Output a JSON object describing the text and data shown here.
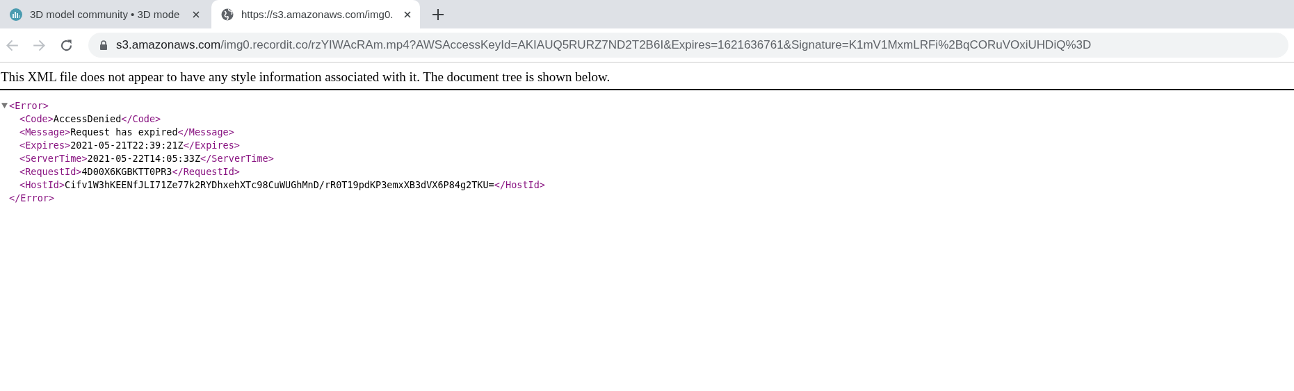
{
  "tabs": [
    {
      "title": "3D model community • 3D mode",
      "kind": "site",
      "selected": false
    },
    {
      "title": "https://s3.amazonaws.com/img0.",
      "kind": "web",
      "selected": true
    }
  ],
  "address_bar": {
    "host": "s3.amazonaws.com",
    "path": "/img0.recordit.co/rzYIWAcRAm.mp4?AWSAccessKeyId=AKIAUQ5RURZ7ND2T2B6I&Expires=1621636761&Signature=K1mV1MxmLRFi%2BqCORuVOxiUHDiQ%3D"
  },
  "notice": "This XML file does not appear to have any style information associated with it. The document tree is shown below.",
  "xml": {
    "open": "<Error>",
    "close": "</Error>",
    "expanded": true,
    "children": [
      {
        "open": "<Code>",
        "text": "AccessDenied",
        "close": "</Code>"
      },
      {
        "open": "<Message>",
        "text": "Request has expired",
        "close": "</Message>"
      },
      {
        "open": "<Expires>",
        "text": "2021-05-21T22:39:21Z",
        "close": "</Expires>"
      },
      {
        "open": "<ServerTime>",
        "text": "2021-05-22T14:05:33Z",
        "close": "</ServerTime>"
      },
      {
        "open": "<RequestId>",
        "text": "4D00X6KGBKTT0PR3",
        "close": "</RequestId>"
      },
      {
        "open": "<HostId>",
        "text": "Cifv1W3hKEENfJLI71Ze77k2RYDhxehXTc98CuWUGhMnD/rR0T19pdKP3emxXB3dVX6P84g2TKU=",
        "close": "</HostId>"
      }
    ]
  }
}
